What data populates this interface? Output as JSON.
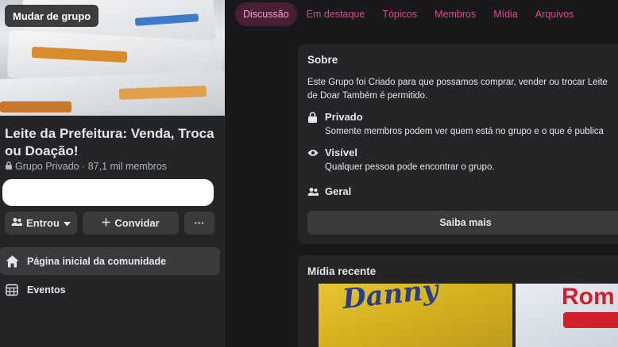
{
  "sidebar": {
    "change_group_label": "Mudar de grupo",
    "group_name": "Leite da Prefeitura: Venda, Troca ou Doação!",
    "group_meta": "Grupo Privado · 87,1 mil membros",
    "joined_label": "Entrou",
    "invite_label": "Convidar",
    "more_label": "···",
    "nav": {
      "home_label": "Página inicial da comunidade",
      "events_label": "Eventos"
    }
  },
  "tabs": [
    {
      "label": "Discussão",
      "active": true
    },
    {
      "label": "Em destaque",
      "active": false
    },
    {
      "label": "Tópicos",
      "active": false
    },
    {
      "label": "Membros",
      "active": false
    },
    {
      "label": "Mídia",
      "active": false
    },
    {
      "label": "Arquivos",
      "active": false
    }
  ],
  "about": {
    "title": "Sobre",
    "description_line1": "Este Grupo foi Criado para que possamos comprar, vender ou trocar Leite",
    "description_line2": "de Doar Também é permitido.",
    "private_title": "Privado",
    "private_sub": "Somente membros podem ver quem está no grupo e o que é publica",
    "visible_title": "Visível",
    "visible_sub": "Qualquer pessoa pode encontrar o grupo.",
    "general_title": "Geral",
    "learn_more_label": "Saiba mais"
  },
  "media": {
    "title": "Mídia recente",
    "thumb1_text": "Danny",
    "thumb2_text": "Rom"
  },
  "colors": {
    "accent_pink": "#e2458f",
    "background": "#18191a",
    "card": "#242526"
  }
}
